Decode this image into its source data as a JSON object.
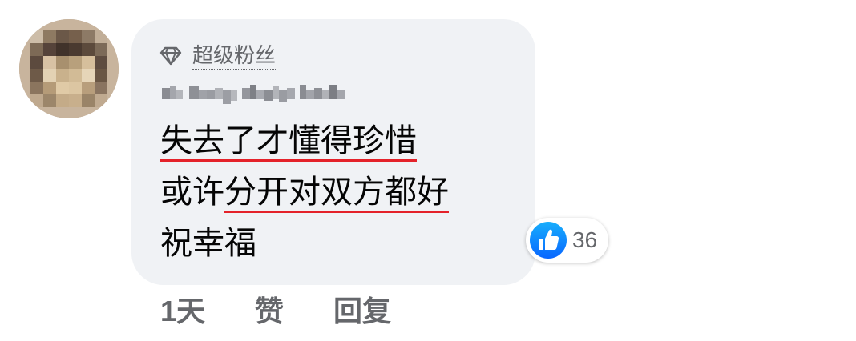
{
  "comment": {
    "badge": {
      "icon": "diamond-icon",
      "label": "超级粉丝"
    },
    "author_name_icon": "blurred-author-name",
    "text_lines": {
      "line1": "失去了才懂得珍惜",
      "line2_plain": "或许",
      "line2_underlined": "分开对双方都好",
      "line3": "祝幸福"
    },
    "reactions": {
      "icon": "like-icon",
      "count": "36"
    },
    "actions": {
      "time": "1天",
      "like": "赞",
      "reply": "回复"
    }
  },
  "colors": {
    "bubble": "#f0f2f5",
    "secondary_text": "#65676b",
    "primary_text": "#050505",
    "underline": "#e4222a",
    "like_blue": "#1877f2"
  }
}
